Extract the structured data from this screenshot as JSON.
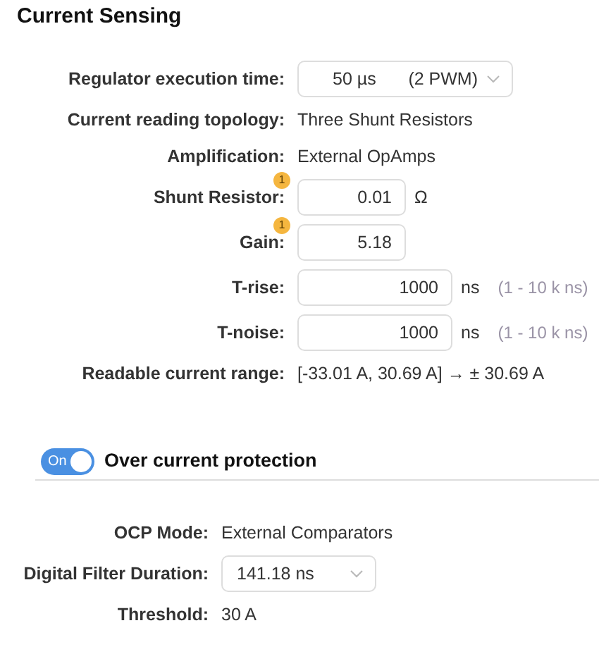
{
  "section": {
    "title": "Current Sensing",
    "rows": [
      {
        "kind": "select",
        "label": "Regulator execution time:",
        "value": "50 µs",
        "value_2": "(2 PWM)"
      },
      {
        "kind": "text",
        "label": "Current reading topology:",
        "value": "Three Shunt Resistors"
      },
      {
        "kind": "text",
        "label": "Amplification:",
        "value": "External OpAmps"
      },
      {
        "kind": "input",
        "label": "Shunt Resistor:",
        "badge": "1",
        "value": "0.01",
        "unit": "Ω"
      },
      {
        "kind": "input",
        "label": "Gain:",
        "badge": "1",
        "value": "5.18"
      },
      {
        "kind": "input",
        "label": "T-rise:",
        "value": "1000",
        "unit": "ns",
        "hint": "(1 - 10 k ns)"
      },
      {
        "kind": "input",
        "label": "T-noise:",
        "value": "1000",
        "unit": "ns",
        "hint": "(1 - 10 k ns)"
      },
      {
        "kind": "text",
        "label": "Readable current range:",
        "value": "[-33.01 A, 30.69 A] → ± 30.69 A"
      }
    ]
  },
  "ocp": {
    "toggle": {
      "label": "On",
      "on": true
    },
    "title": "Over current protection",
    "rows": [
      {
        "kind": "text",
        "label": "OCP Mode:",
        "value": "External Comparators"
      },
      {
        "kind": "select",
        "label": "Digital Filter Duration:",
        "value": "141.18 ns"
      },
      {
        "kind": "text",
        "label": "Threshold:",
        "value": "30 A"
      }
    ]
  }
}
